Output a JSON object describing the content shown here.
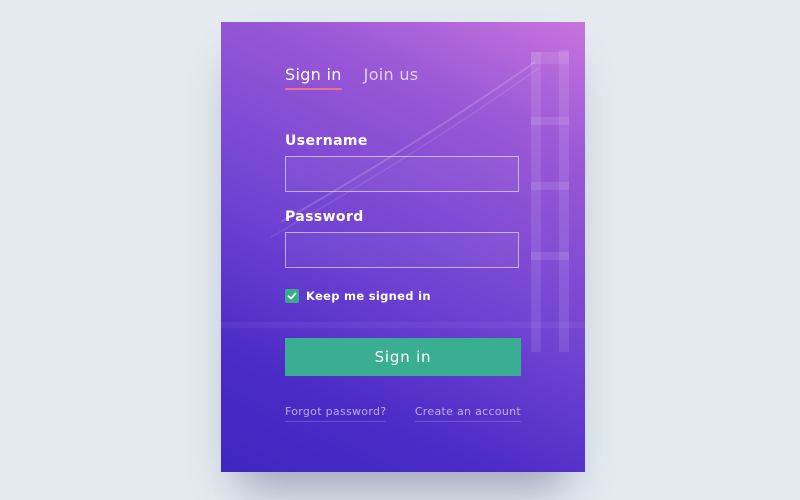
{
  "tabs": {
    "signin": "Sign in",
    "joinus": "Join us"
  },
  "form": {
    "username_label": "Username",
    "username_value": "",
    "password_label": "Password",
    "password_value": "",
    "remember_label": "Keep me signed in",
    "remember_checked": true,
    "submit_label": "Sign in"
  },
  "links": {
    "forgot": "Forgot password?",
    "create": "Create an account"
  },
  "colors": {
    "accent_green": "#3aae91",
    "tab_underline": "#ef6f8c",
    "gradient_top": "#c873de",
    "gradient_bottom": "#3f26c0",
    "page_background": "#e3ebf0"
  },
  "icons": {
    "checkbox": "check-icon",
    "background": "bridge-illustration"
  }
}
